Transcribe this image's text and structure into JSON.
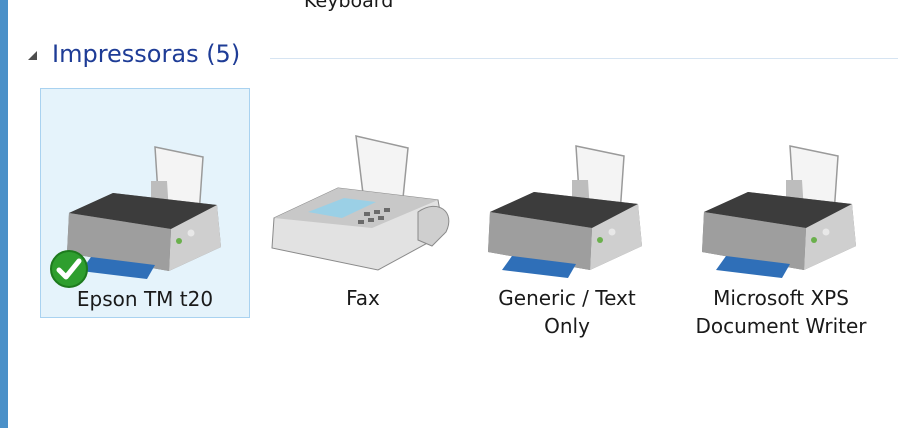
{
  "previous_item_label": "Keyboard",
  "group": {
    "title": "Impressoras (5)",
    "expanded": true
  },
  "devices": [
    {
      "label": "Epson TM t20",
      "icon": "printer-icon",
      "selected": true,
      "default": true
    },
    {
      "label": "Fax",
      "icon": "fax-icon",
      "selected": false,
      "default": false
    },
    {
      "label": "Generic / Text\nOnly",
      "icon": "printer-icon",
      "selected": false,
      "default": false
    },
    {
      "label": "Microsoft XPS\nDocument Writer",
      "icon": "printer-icon",
      "selected": false,
      "default": false
    }
  ],
  "colors": {
    "group_title": "#1e3c96",
    "selection_fill": "#e5f3fb",
    "selection_border": "#a9d2f0",
    "left_rail": "#4a90c8",
    "default_check": "#2e9e2e"
  }
}
